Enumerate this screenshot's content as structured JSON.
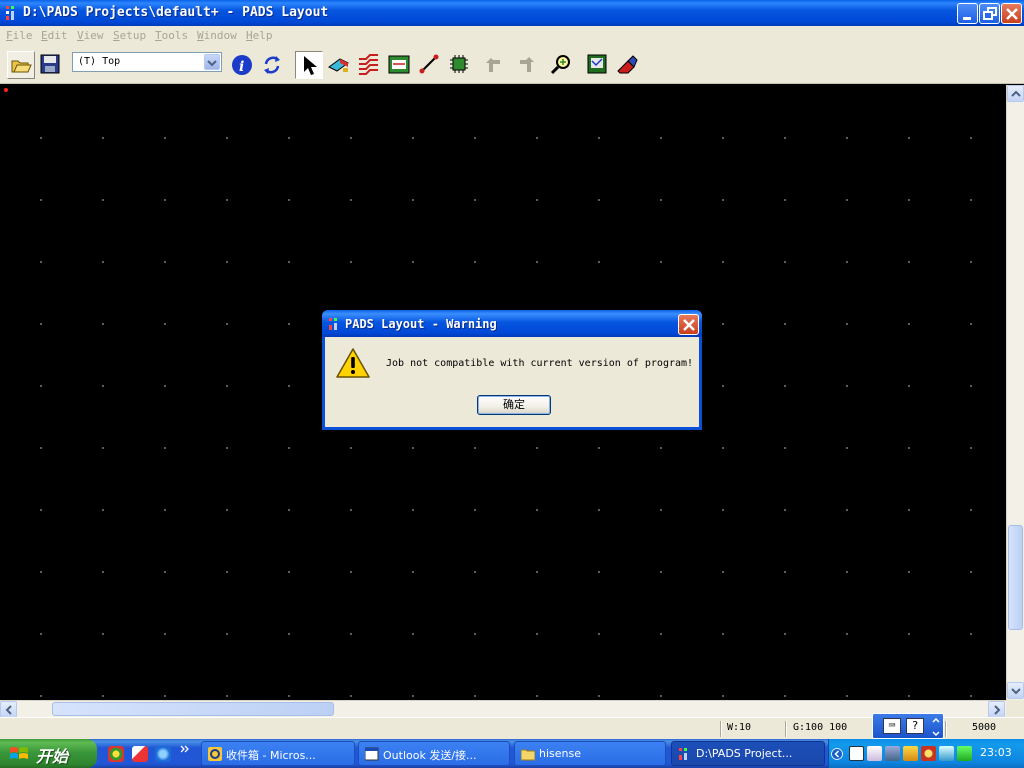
{
  "window": {
    "title": "D:\\PADS Projects\\default+ - PADS Layout"
  },
  "menu": [
    "File",
    "Edit",
    "View",
    "Setup",
    "Tools",
    "Window",
    "Help"
  ],
  "toolbar": {
    "layer_select_value": "(T) Top",
    "icons": [
      "open-folder-icon",
      "save-icon",
      "info-icon",
      "refresh-icon",
      "select-arrow-icon",
      "drafting-toolbar-icon",
      "design-toolbar-icon",
      "dimensioning-toolbar-icon",
      "route-icon",
      "component-icon",
      "undo-icon",
      "redo-icon",
      "zoom-icon",
      "board-icon",
      "eraser-icon"
    ]
  },
  "status": {
    "width": "W:10",
    "grid": "G:100 100",
    "coord": "5000"
  },
  "dialog": {
    "title": "PADS Layout - Warning",
    "message": "Job not compatible with current version of program!",
    "ok_label": "确定"
  },
  "taskbar": {
    "start_label": "开始",
    "tasks": [
      {
        "label": "收件箱 - Micros..."
      },
      {
        "label": "Outlook 发送/接..."
      },
      {
        "label": "hisense"
      },
      {
        "label": "D:\\PADS Project..."
      }
    ],
    "clock": "23:03"
  }
}
